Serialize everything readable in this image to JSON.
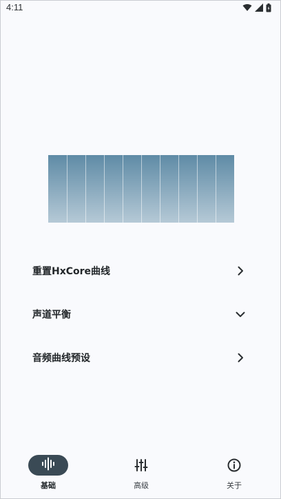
{
  "status_bar": {
    "time": "4:11"
  },
  "equalizer": {
    "band_count": 10
  },
  "menu": {
    "items": [
      {
        "label": "重置HxCore曲线",
        "chevron": "chevron-right-icon"
      },
      {
        "label": "声道平衡",
        "chevron": "chevron-down-icon"
      },
      {
        "label": "音频曲线预设",
        "chevron": "chevron-right-icon"
      }
    ]
  },
  "bottom_nav": {
    "items": [
      {
        "label": "基础",
        "icon": "waveform-icon",
        "active": true
      },
      {
        "label": "高级",
        "icon": "sliders-icon",
        "active": false
      },
      {
        "label": "关于",
        "icon": "info-icon",
        "active": false
      }
    ]
  },
  "colors": {
    "background": "#f9fafd",
    "panel_top": "#5f8ba6",
    "panel_bottom": "#b5c9d6",
    "nav_active_pill": "#3a4a55"
  }
}
